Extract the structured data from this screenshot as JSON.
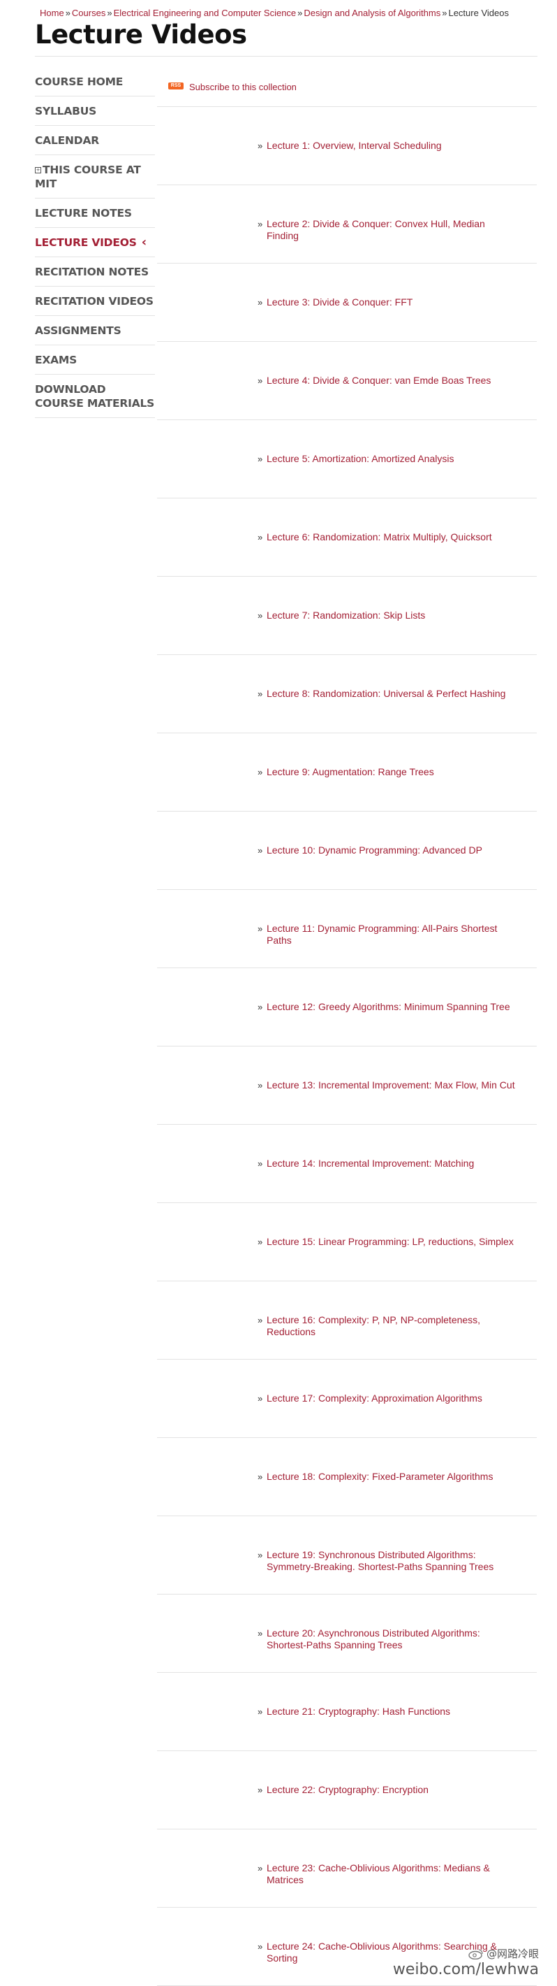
{
  "breadcrumb": {
    "items": [
      "Home",
      "Courses",
      "Electrical Engineering and Computer Science",
      "Design and Analysis of Algorithms"
    ],
    "current": "Lecture Videos",
    "separator": "»"
  },
  "page_title": "Lecture Videos",
  "sidebar": {
    "items": [
      {
        "label": "Course Home"
      },
      {
        "label": "Syllabus"
      },
      {
        "label": "Calendar"
      },
      {
        "label": "This Course at MIT"
      },
      {
        "label": "Lecture Notes"
      },
      {
        "label": "Lecture Videos",
        "active": true
      },
      {
        "label": "Recitation Notes"
      },
      {
        "label": "Recitation Videos"
      },
      {
        "label": "Assignments"
      },
      {
        "label": "Exams"
      },
      {
        "label": "Download Course Materials"
      }
    ]
  },
  "rss": {
    "badge": "RSS",
    "label": "Subscribe to this collection"
  },
  "lectures": [
    "Lecture 1: Overview, Interval Scheduling",
    "Lecture 2: Divide & Conquer: Convex Hull, Median Finding",
    "Lecture 3: Divide & Conquer: FFT",
    "Lecture 4: Divide & Conquer: van Emde Boas Trees",
    "Lecture 5: Amortization: Amortized Analysis",
    "Lecture 6: Randomization: Matrix Multiply, Quicksort",
    "Lecture 7: Randomization: Skip Lists",
    "Lecture 8: Randomization: Universal & Perfect Hashing",
    "Lecture 9: Augmentation: Range Trees",
    "Lecture 10: Dynamic Programming: Advanced DP",
    "Lecture 11: Dynamic Programming: All-Pairs Shortest Paths",
    "Lecture 12: Greedy Algorithms: Minimum Spanning Tree",
    "Lecture 13: Incremental Improvement: Max Flow, Min Cut",
    "Lecture 14: Incremental Improvement: Matching",
    "Lecture 15: Linear Programming: LP, reductions, Simplex",
    "Lecture 16: Complexity: P, NP, NP-completeness, Reductions",
    "Lecture 17: Complexity: Approximation Algorithms",
    "Lecture 18: Complexity: Fixed-Parameter Algorithms",
    "Lecture 19: Synchronous Distributed Algorithms: Symmetry-Breaking. Shortest-Paths Spanning Trees",
    "Lecture 20: Asynchronous Distributed Algorithms: Shortest-Paths Spanning Trees",
    "Lecture 21: Cryptography: Hash Functions",
    "Lecture 22: Cryptography: Encryption",
    "Lecture 23: Cache-Oblivious Algorithms: Medians & Matrices",
    "Lecture 24: Cache-Oblivious Algorithms: Searching & Sorting"
  ],
  "watermark": {
    "handle": "@网路冷眼",
    "site": "weibo.com/lewhwa"
  },
  "colors": {
    "link": "#a31f34",
    "rss": "#f26522",
    "divider": "#e3e3e3"
  }
}
